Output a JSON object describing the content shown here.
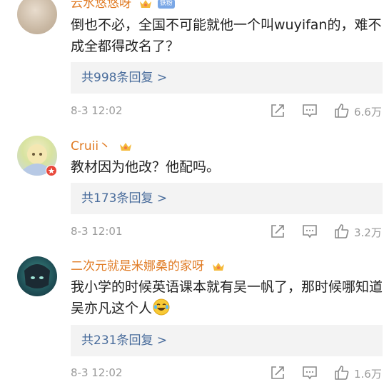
{
  "comments": [
    {
      "username": "云水悠悠呀",
      "badge": "铁粉",
      "text": "倒也不必，全国不可能就他一个叫wuyifan的，难不成全都得改名了？",
      "replies": "共998条回复 >",
      "time": "8-3 12:02",
      "likes": "6.6万"
    },
    {
      "username": "Cruii丶",
      "text": "教材因为他改？他配吗。",
      "replies": "共173条回复 >",
      "time": "8-3 12:01",
      "likes": "3.2万"
    },
    {
      "username": "二次元就是米娜桑的家呀",
      "text": "我小学的时候英语课本就有吴一帆了，那时候哪知道吴亦凡这个人",
      "emoji": "laugh-cry-emoji",
      "replies": "共231条回复 >",
      "time": "8-3 12:02",
      "likes": "1.6万"
    }
  ],
  "colors": {
    "username": "#e07b24",
    "reply_link": "#4a6d9c",
    "meta": "#9a9a9a"
  }
}
